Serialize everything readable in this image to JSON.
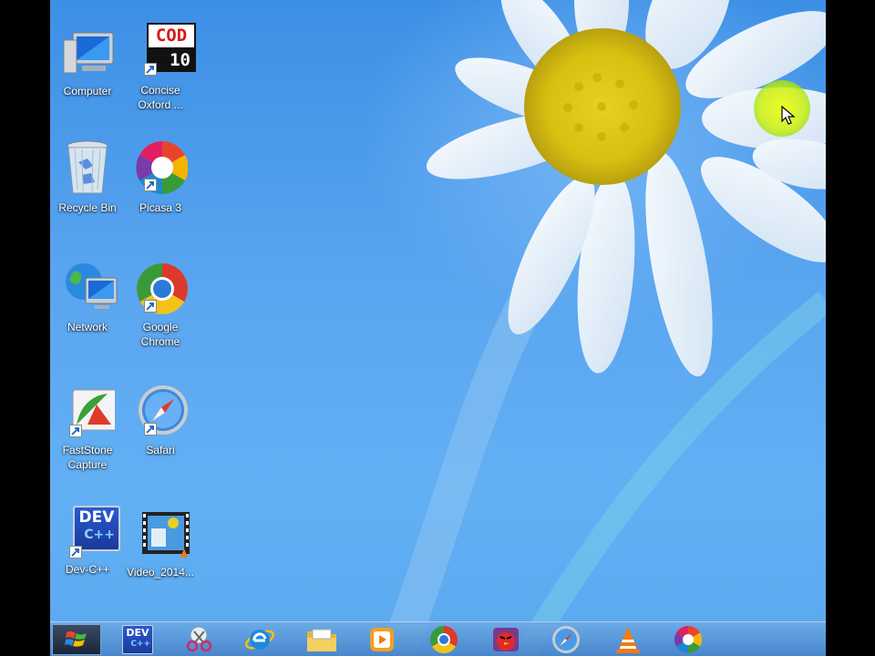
{
  "desktop": {
    "icons": [
      {
        "label_line1": "Computer",
        "label_line2": ""
      },
      {
        "label_line1": "Concise",
        "label_line2": "Oxford ..."
      },
      {
        "label_line1": "Recycle Bin",
        "label_line2": ""
      },
      {
        "label_line1": "Picasa 3",
        "label_line2": ""
      },
      {
        "label_line1": "Network",
        "label_line2": ""
      },
      {
        "label_line1": "Google",
        "label_line2": "Chrome"
      },
      {
        "label_line1": "FastStone",
        "label_line2": "Capture"
      },
      {
        "label_line1": "Safari",
        "label_line2": ""
      },
      {
        "label_line1": "Dev-C++",
        "label_line2": ""
      },
      {
        "label_line1": "Video_2014...",
        "label_line2": ""
      }
    ],
    "cod_icon_text_top": "COD",
    "cod_icon_text_bottom": "10",
    "dev_icon_text": "DEV",
    "dev_icon_subtext": "C++"
  },
  "taskbar": {
    "items": [
      {
        "icon": "windows-start-icon"
      },
      {
        "icon": "dev-cpp-icon"
      },
      {
        "icon": "snipping-tool-icon"
      },
      {
        "icon": "internet-explorer-icon"
      },
      {
        "icon": "file-explorer-icon"
      },
      {
        "icon": "media-player-icon"
      },
      {
        "icon": "chrome-icon"
      },
      {
        "icon": "angry-birds-icon"
      },
      {
        "icon": "safari-icon"
      },
      {
        "icon": "vlc-icon"
      },
      {
        "icon": "picasa-icon"
      }
    ]
  },
  "colors": {
    "wallpaper_blue": "#4a9aea",
    "highlight": "#e6f500"
  }
}
